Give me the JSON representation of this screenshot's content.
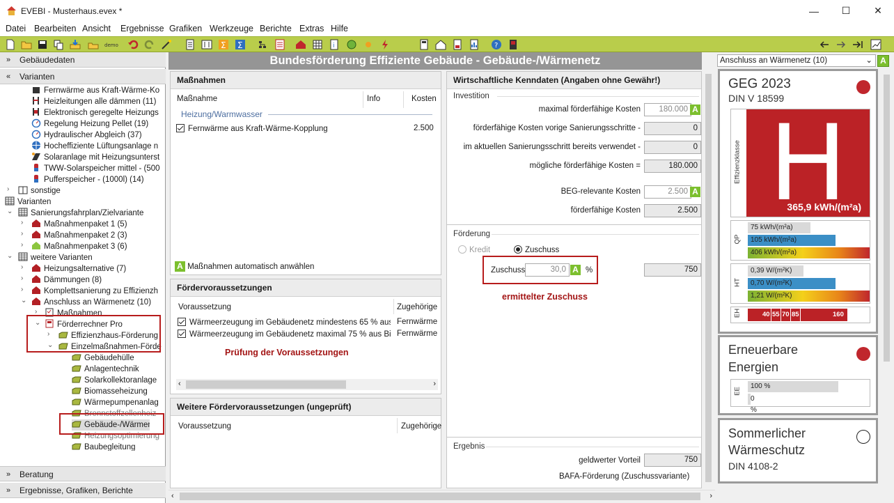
{
  "window": {
    "title": "EVEBI  - Musterhaus.evex *",
    "minimize": "—",
    "maximize": "☐",
    "close": "✕"
  },
  "menu": [
    "Datei",
    "Bearbeiten",
    "Ansicht",
    "Ergebnisse",
    "Grafiken",
    "Werkzeuge",
    "Berichte",
    "Extras",
    "Hilfe"
  ],
  "left": {
    "section_gebaeude": "Gebäudedaten",
    "section_varianten": "Varianten",
    "section_beratung": "Beratung",
    "section_ergebnisse": "Ergebnisse, Grafiken, Berichte",
    "tree": [
      "Fernwärme aus Kraft-Wärme-Ko",
      "Heizleitungen alle dämmen (11)",
      "Elektronisch geregelte Heizungs",
      "Regelung Heizung Pellet (19)",
      "Hydraulischer Abgleich (37)",
      "Hocheffiziente Lüftungsanlage n",
      "Solaranlage mit Heizungsunterst",
      "TWW-Solarspeicher mittel - (500",
      "Pufferspeicher - (1000l) (14)",
      "sonstige",
      "Varianten",
      "Sanierungsfahrplan/Zielvariante",
      "Maßnahmenpaket 1 (5)",
      "Maßnahmenpaket 2 (3)",
      "Maßnahmenpaket 3 (6)",
      "weitere Varianten",
      "Heizungsalternative (7)",
      "Dämmungen (8)",
      "Komplettsanierung zu Effizienzh",
      "Anschluss an Wärmenetz (10)",
      "Maßnahmen",
      "Förderrechner Pro",
      "Effizienzhaus-Förderung",
      "Einzelmaßnahmen-Förde",
      "Gebäudehülle",
      "Anlagentechnik",
      "Solarkollektoranlage",
      "Biomasseheizung",
      "Wärmepumpenanlag",
      "Brennstoffzellenheiz",
      "Gebäude-/Wärmene",
      "Heizungsoptimierung",
      "Baubegleitung"
    ]
  },
  "banner": "Bundesförderung Effiziente Gebäude - Gebäude-/Wärmenetz",
  "massnahmen": {
    "title": "Maßnahmen",
    "col_massnahme": "Maßnahme",
    "col_info": "Info",
    "col_kosten": "Kosten",
    "group": "Heizung/Warmwasser",
    "row_name": "Fernwärme aus Kraft-Wärme-Kopplung",
    "row_cost": "2.500",
    "auto_label": "Maßnahmen automatisch anwählen",
    "A": "A"
  },
  "voraussetzungen": {
    "title": "Fördervoraussetzungen",
    "col1": "Voraussetzung",
    "col2": "Zugehörige F",
    "rows": [
      {
        "text": "Wärmeerzeugung im Gebäudenetz mindestens 65 % aus ...",
        "val": "Fernwärme a"
      },
      {
        "text": "Wärmeerzeugung im Gebäudenetz maximal 75 % aus Bio...",
        "val": "Fernwärme a"
      }
    ],
    "annotation": "Prüfung der Voraussetzungen"
  },
  "weitere": {
    "title": "Weitere Fördervoraussetzungen (ungeprüft)",
    "col1": "Voraussetzung",
    "col2": "Zugehörige"
  },
  "wirtschaft": {
    "title": "Wirtschaftliche Kenndaten (Angaben ohne Gewähr!)",
    "investition": "Investition",
    "rows": [
      {
        "label": "maximal förderfähige Kosten",
        "value": "180.000"
      },
      {
        "label": "förderfähige Kosten vorige Sanierungsschritte -",
        "value": "0"
      },
      {
        "label": "im aktuellen Sanierungsschritt bereits verwendet -",
        "value": "0"
      },
      {
        "label": "mögliche förderfähige Kosten =",
        "value": "180.000"
      },
      {
        "label": "BEG-relevante Kosten",
        "value": "2.500"
      },
      {
        "label": "förderfähige Kosten",
        "value": "2.500"
      }
    ],
    "foerderung": "Förderung",
    "kredit": "Kredit",
    "zuschuss": "Zuschuss",
    "zuschuss_label": "Zuschuss",
    "zuschuss_value": "30,0",
    "percent": "%",
    "zuschuss_result": "750",
    "annotation": "ermittelter Zuschuss",
    "ergebnis": "Ergebnis",
    "geldwert_label": "geldwerter Vorteil",
    "geldwert_value": "750",
    "bafa": "BAFA-Förderung (Zuschussvariante)"
  },
  "right": {
    "dropdown": "Anschluss an Wärmenetz (10)",
    "geg_title": "GEG 2023",
    "geg_sub": "DIN V 18599",
    "effizienz_label": "Effizienzklasse",
    "klasse": "H",
    "kwh": "365,9 kWh/(m²a)",
    "qp_label": "QP",
    "qp_bars": [
      "75 kWh/(m²a)",
      "105 kWh/(m²a)",
      "406 kWh/(m²a)"
    ],
    "ht_label": "HT",
    "ht_bars": [
      "0,39 W/(m²K)",
      "0,70 W/(m²K)",
      "1,21 W/(m²K)"
    ],
    "eh_label": "EH",
    "eh_ticks": [
      "40",
      "55",
      "70",
      "85",
      "160"
    ],
    "ee_title1": "Erneuerbare",
    "ee_title2": "Energien",
    "ee_label": "EE",
    "ee_bars": [
      "100 %",
      "0 %"
    ],
    "sw_title1": "Sommerlicher",
    "sw_title2": "Wärmeschutz",
    "sw_sub": "DIN 4108-2"
  },
  "colors": {
    "toolbar": "#b9cd4b",
    "red": "#c0272d",
    "annotation": "#a31515",
    "green": "#7cbf2e",
    "blue": "#3b8fc6"
  }
}
